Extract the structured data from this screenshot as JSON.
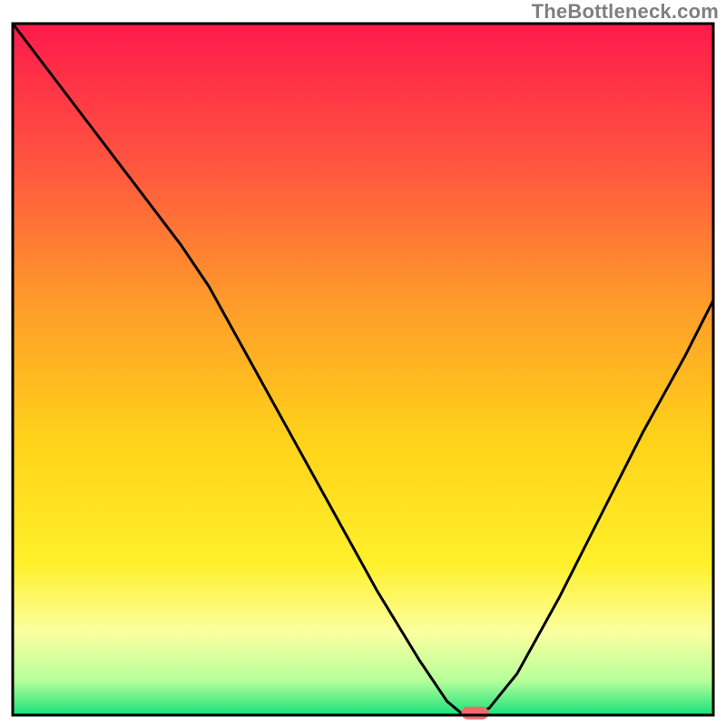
{
  "watermark": "TheBottleneck.com",
  "chart_data": {
    "type": "line",
    "title": "",
    "xlabel": "",
    "ylabel": "",
    "xlim": [
      0,
      100
    ],
    "ylim": [
      0,
      100
    ],
    "grid": false,
    "legend": false,
    "note": "No numeric axis ticks or data labels are visible in the image; the single black curve is a V-shape dipping to zero near x≈66; the red rounded marker sits at the trough; x/y values below are estimated visual proportions along each axis (0–100).",
    "curve": {
      "name": "bottleneck-curve",
      "x": [
        0,
        6,
        12,
        18,
        24,
        28,
        34,
        40,
        46,
        52,
        58,
        62,
        64,
        66,
        68,
        72,
        78,
        84,
        90,
        96,
        100
      ],
      "y": [
        100,
        92,
        84,
        76,
        68,
        62,
        51,
        40,
        29,
        18,
        8,
        2,
        0.3,
        0.3,
        1,
        6,
        17,
        29,
        41,
        52,
        60
      ]
    },
    "marker": {
      "name": "optimal-point",
      "x": 66,
      "y": 0.3
    },
    "background_gradient": {
      "type": "vertical",
      "stops": [
        {
          "pos": 0.0,
          "color": "#ff1a4b"
        },
        {
          "pos": 0.2,
          "color": "#ff5440"
        },
        {
          "pos": 0.4,
          "color": "#ff9a2a"
        },
        {
          "pos": 0.6,
          "color": "#ffd21a"
        },
        {
          "pos": 0.78,
          "color": "#fff02a"
        },
        {
          "pos": 0.88,
          "color": "#fcffa0"
        },
        {
          "pos": 0.95,
          "color": "#b7ff9a"
        },
        {
          "pos": 1.0,
          "color": "#18e07a"
        }
      ]
    },
    "border_color": "#000000",
    "border_width": 3
  }
}
